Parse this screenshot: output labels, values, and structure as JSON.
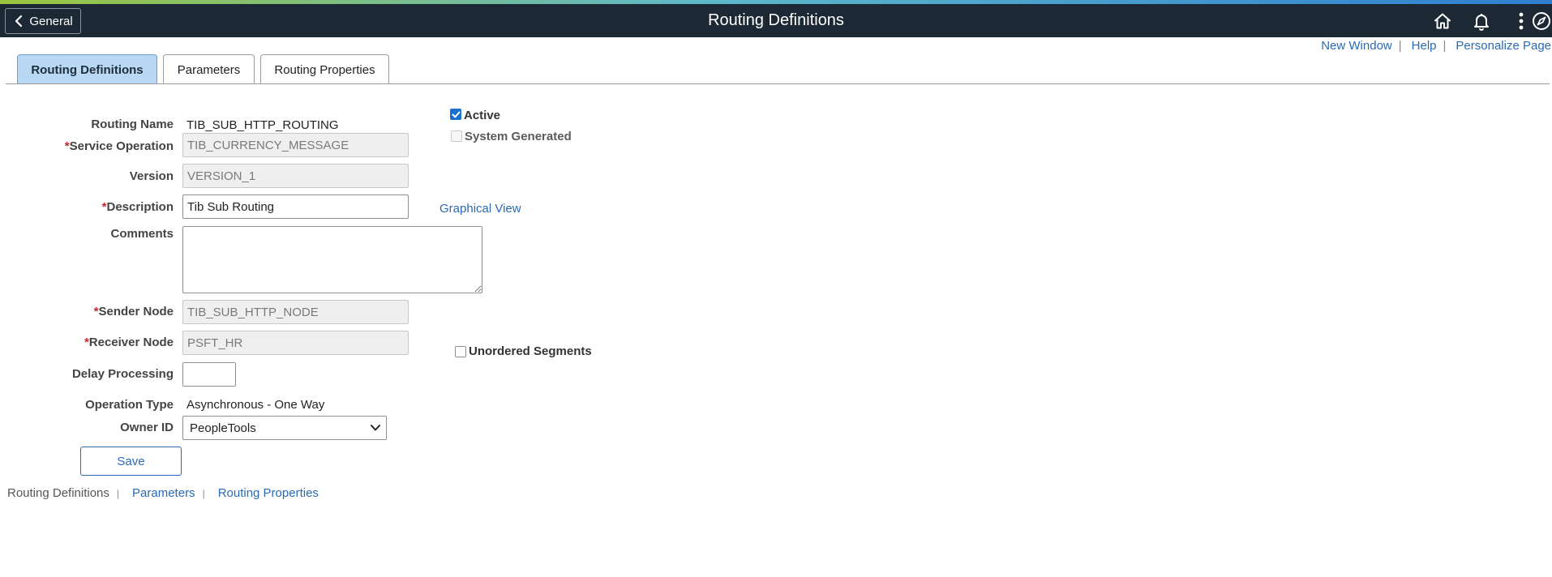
{
  "header": {
    "back_label": "General",
    "title": "Routing Definitions",
    "icons": [
      "home-icon",
      "bell-icon",
      "more-actions-icon",
      "navbar-icon"
    ],
    "banner_color": "#1c2833"
  },
  "top_links": {
    "new_window": "New Window",
    "help": "Help",
    "personalize": "Personalize Page",
    "separator": "|"
  },
  "tabs": [
    {
      "label": "Routing Definitions",
      "active": true
    },
    {
      "label": "Parameters",
      "active": false
    },
    {
      "label": "Routing Properties",
      "active": false
    }
  ],
  "form": {
    "required_mark": "*",
    "routing_name": {
      "label": "Routing Name",
      "value": "TIB_SUB_HTTP_ROUTING"
    },
    "service_operation": {
      "label": "Service Operation",
      "value": "TIB_CURRENCY_MESSAGE"
    },
    "version": {
      "label": "Version",
      "value": "VERSION_1"
    },
    "description": {
      "label": "Description",
      "value": "Tib Sub Routing"
    },
    "comments": {
      "label": "Comments",
      "value": ""
    },
    "sender_node": {
      "label": "Sender Node",
      "value": "TIB_SUB_HTTP_NODE"
    },
    "receiver_node": {
      "label": "Receiver Node",
      "value": "PSFT_HR"
    },
    "delay_processing": {
      "label": "Delay Processing",
      "value": ""
    },
    "operation_type": {
      "label": "Operation Type",
      "value": "Asynchronous - One Way"
    },
    "owner_id": {
      "label": "Owner ID",
      "value": "PeopleTools"
    }
  },
  "checkboxes": {
    "active": {
      "label": "Active",
      "checked": true
    },
    "system_generated": {
      "label": "System Generated",
      "checked": false,
      "disabled": true
    },
    "unordered_segments": {
      "label": "Unordered Segments",
      "checked": false
    }
  },
  "graphical_view": "Graphical View",
  "save_label": "Save",
  "bottom_links": {
    "current": "Routing Definitions",
    "parameters": "Parameters",
    "routing_properties": "Routing Properties",
    "separator": "|"
  },
  "colors": {
    "link": "#2a6ab4",
    "active_tab": "#b9d8f3",
    "required": "#c4262e",
    "checkbox_checked": "#1b6fd1"
  }
}
